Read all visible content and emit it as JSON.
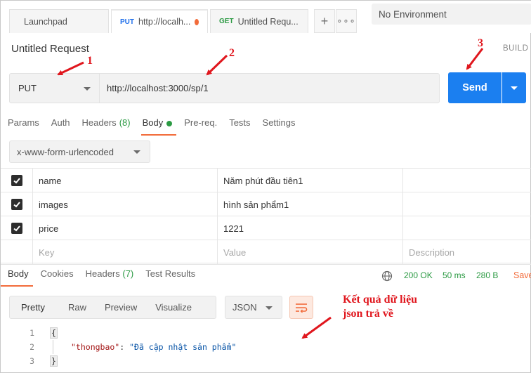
{
  "tabs": [
    {
      "label": "Launchpad"
    },
    {
      "method": "PUT",
      "label": "http://localh...",
      "active": true,
      "unsaved": true
    },
    {
      "method": "GET",
      "label": "Untitled Requ..."
    }
  ],
  "tab_actions": {
    "add_icon": "plus-icon",
    "more_icon": "ellipsis-icon"
  },
  "environment": {
    "selected": "No Environment"
  },
  "request": {
    "title": "Untitled Request",
    "build_label": "BUILD",
    "method": "PUT",
    "url": "http://localhost:3000/sp/1",
    "send_label": "Send"
  },
  "request_tabs": [
    {
      "label": "Params"
    },
    {
      "label": "Auth"
    },
    {
      "label": "Headers",
      "count": "(8)"
    },
    {
      "label": "Body",
      "active": true
    },
    {
      "label": "Pre-req."
    },
    {
      "label": "Tests"
    },
    {
      "label": "Settings"
    }
  ],
  "body_encoding": "x-www-form-urlencoded",
  "form_rows": [
    {
      "checked": true,
      "key": "name",
      "value": "Năm phút đầu tiên1"
    },
    {
      "checked": true,
      "key": "images",
      "value": "hình sản phẩm1"
    },
    {
      "checked": true,
      "key": "price",
      "value": "1221"
    }
  ],
  "form_placeholder": {
    "key": "Key",
    "value": "Value",
    "description": "Description"
  },
  "response_tabs": [
    {
      "label": "Body",
      "active": true
    },
    {
      "label": "Cookies"
    },
    {
      "label": "Headers",
      "count": "(7)"
    },
    {
      "label": "Test Results"
    }
  ],
  "response_status": {
    "status": "200 OK",
    "time": "50 ms",
    "size": "280 B",
    "save_label": "Save"
  },
  "view_modes": [
    "Pretty",
    "Raw",
    "Preview",
    "Visualize"
  ],
  "format": "JSON",
  "code_lines": [
    {
      "n": "1",
      "text": "{"
    },
    {
      "n": "2",
      "key": "\"thongbao\"",
      "sep": ": ",
      "value": "\"Đã cập nhật sản phẩm\""
    },
    {
      "n": "3",
      "text": "}"
    }
  ],
  "annotations": {
    "n1": "1",
    "n2": "2",
    "n3": "3",
    "note_line1": "Kết quả dữ liệu",
    "note_line2": "json trả về"
  },
  "colors": {
    "accent": "#f26b3a",
    "send": "#1b7ff0",
    "success": "#2b9a43",
    "annotation": "#e0161d"
  }
}
